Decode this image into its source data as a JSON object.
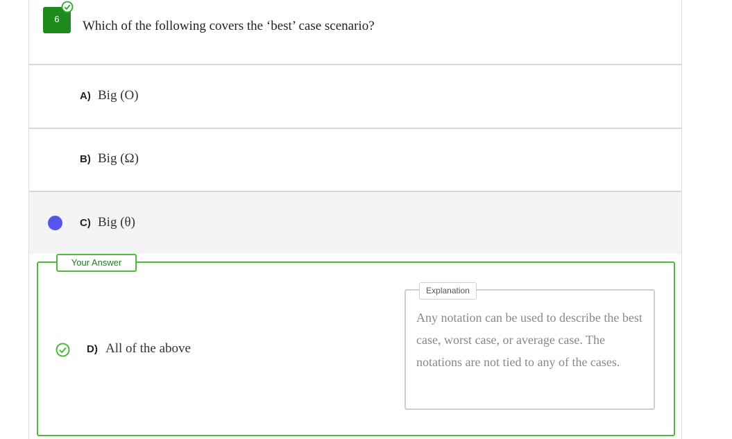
{
  "question": {
    "number": "6",
    "text": "Which of the following covers the ‘best’ case scenario?"
  },
  "options": [
    {
      "letter": "A)",
      "text": "Big (O)"
    },
    {
      "letter": "B)",
      "text": "Big (Ω)"
    },
    {
      "letter": "C)",
      "text": "Big (θ)"
    }
  ],
  "answer": {
    "tag": "Your Answer",
    "letter": "D)",
    "text": "All of the above"
  },
  "explanation": {
    "tag": "Explanation",
    "text": "Any notation can be used to describe the best case, worst case, or average case. The notations are not tied to any of the cases."
  },
  "colors": {
    "question_badge": "#1e8a1e",
    "selected_dot": "#5555ee",
    "correct": "#4cbb3a"
  }
}
